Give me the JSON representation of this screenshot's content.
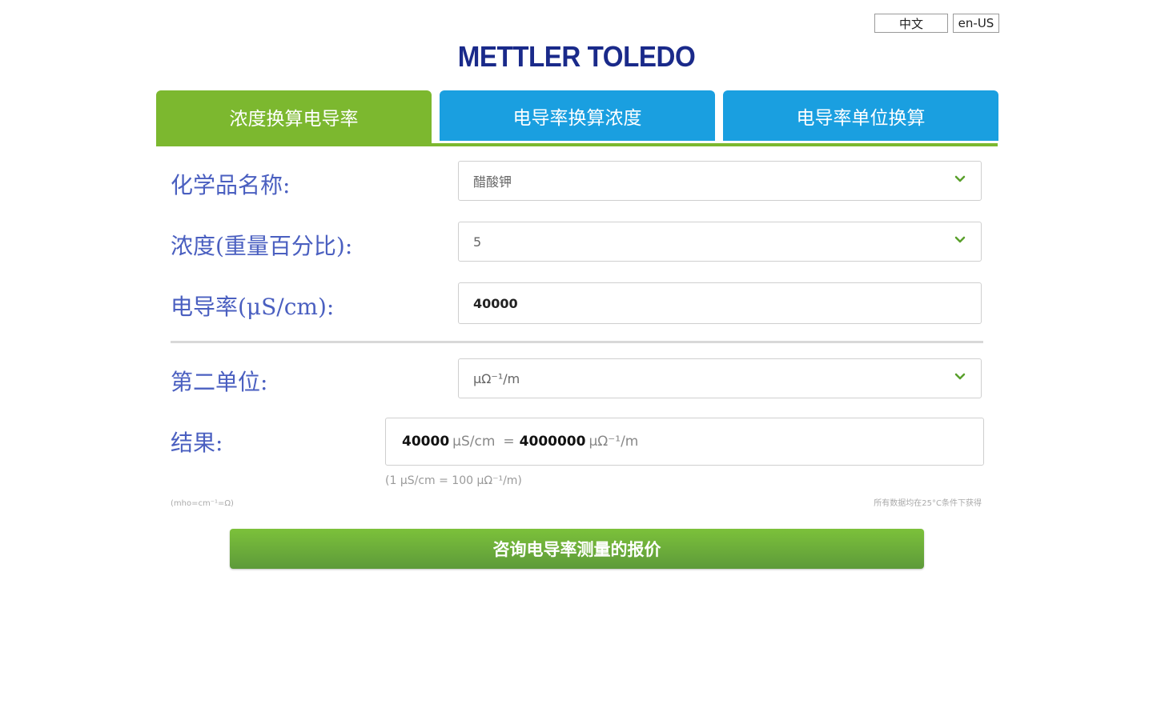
{
  "language": {
    "zh_label": "中文",
    "en_label": "en-US"
  },
  "brand": {
    "logo_text": "METTLER TOLEDO",
    "logo_color": "#1a2a8a"
  },
  "tabs": [
    {
      "label": "浓度换算电导率",
      "active": true,
      "color": "#7cb82f"
    },
    {
      "label": "电导率换算浓度",
      "active": false,
      "color": "#1a9fe0"
    },
    {
      "label": "电导率单位换算",
      "active": false,
      "color": "#1a9fe0"
    }
  ],
  "form": {
    "chemical": {
      "label": "化学品名称:",
      "value": "醋酸钾"
    },
    "concentration": {
      "label": "浓度(重量百分比):",
      "value": "5"
    },
    "conductivity": {
      "label": "电导率(μS/cm):",
      "value": "40000"
    },
    "second_unit": {
      "label": "第二单位:",
      "value": "μΩ⁻¹/m"
    }
  },
  "result": {
    "label": "结果:",
    "value": "40000",
    "unit": "μS/cm",
    "equals": "=",
    "converted_value": "4000000",
    "converted_unit": "μΩ⁻¹/m",
    "ratio_note": "(1 μS/cm = 100 μΩ⁻¹/m)"
  },
  "footnotes": {
    "left": "(mho=cm⁻¹=Ω)",
    "right": "所有数据均在25°C条件下获得"
  },
  "cta": {
    "label": "咨询电导率测量的报价"
  },
  "colors": {
    "accent_green": "#7cb82f",
    "tab_blue": "#1a9fe0",
    "label_blue": "#4a5fc0"
  }
}
